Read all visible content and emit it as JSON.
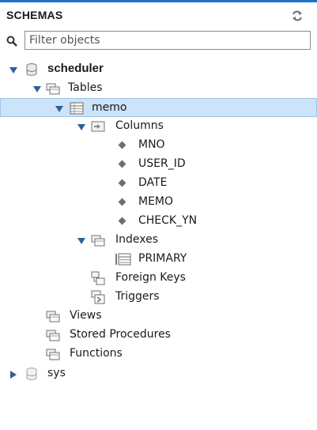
{
  "panel": {
    "title": "SCHEMAS",
    "refresh_icon": "refresh-icon"
  },
  "filter": {
    "placeholder": "Filter objects",
    "icon": "search-icon"
  },
  "tree": {
    "schema1": {
      "label": "scheduler",
      "icon": "database-icon",
      "expanded": true
    },
    "tables": {
      "label": "Tables"
    },
    "table_memo": {
      "label": "memo",
      "selected": true
    },
    "columns": {
      "label": "Columns"
    },
    "column_items": [
      "MNO",
      "USER_ID",
      "DATE",
      "MEMO",
      "CHECK_YN"
    ],
    "indexes": {
      "label": "Indexes"
    },
    "index_items": [
      "PRIMARY"
    ],
    "foreign_keys": {
      "label": "Foreign Keys"
    },
    "triggers": {
      "label": "Triggers"
    },
    "views": {
      "label": "Views"
    },
    "stored_procedures": {
      "label": "Stored Procedures"
    },
    "functions": {
      "label": "Functions"
    },
    "schema2": {
      "label": "sys",
      "icon": "database-icon",
      "expanded": false
    }
  },
  "colors": {
    "accent": "#1e73cf",
    "selection": "#cde3f7"
  }
}
